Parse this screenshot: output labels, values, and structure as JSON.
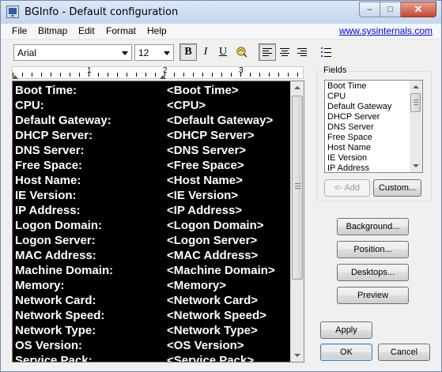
{
  "window": {
    "title": "BGInfo - Default configuration",
    "controls": {
      "minimize": "–",
      "maximize": "□",
      "close": "✕"
    }
  },
  "menu": {
    "items": [
      "File",
      "Bitmap",
      "Edit",
      "Format",
      "Help"
    ],
    "link": "www.sysinternals.com"
  },
  "toolbar": {
    "font": "Arial",
    "size": "12",
    "bold": "B",
    "italic": "I",
    "underline": "U",
    "icons": [
      "bold-icon",
      "italic-icon",
      "underline-icon",
      "insert-image-icon",
      "align-left-icon",
      "align-center-icon",
      "align-right-icon",
      "bullet-list-icon"
    ]
  },
  "ruler": {
    "marks": [
      "1",
      "2",
      "3"
    ]
  },
  "editor": {
    "lines": [
      {
        "label": "Boot Time:",
        "value": "<Boot Time>"
      },
      {
        "label": "CPU:",
        "value": "<CPU>"
      },
      {
        "label": "Default Gateway:",
        "value": "<Default Gateway>"
      },
      {
        "label": "DHCP Server:",
        "value": "<DHCP Server>"
      },
      {
        "label": "DNS Server:",
        "value": "<DNS Server>"
      },
      {
        "label": "Free Space:",
        "value": "<Free Space>"
      },
      {
        "label": "Host Name:",
        "value": "<Host Name>"
      },
      {
        "label": "IE Version:",
        "value": "<IE Version>"
      },
      {
        "label": "IP Address:",
        "value": "<IP Address>"
      },
      {
        "label": "Logon Domain:",
        "value": "<Logon Domain>"
      },
      {
        "label": "Logon Server:",
        "value": "<Logon Server>"
      },
      {
        "label": "MAC Address:",
        "value": "<MAC Address>"
      },
      {
        "label": "Machine Domain:",
        "value": "<Machine Domain>"
      },
      {
        "label": "Memory:",
        "value": "<Memory>"
      },
      {
        "label": "Network Card:",
        "value": "<Network Card>"
      },
      {
        "label": "Network Speed:",
        "value": "<Network Speed>"
      },
      {
        "label": "Network Type:",
        "value": "<Network Type>"
      },
      {
        "label": "OS Version:",
        "value": "<OS Version>"
      },
      {
        "label": "Service Pack:",
        "value": "<Service Pack>"
      }
    ],
    "background_color": "#000000",
    "text_color": "#ffffff"
  },
  "fields": {
    "legend": "Fields",
    "items": [
      "Boot Time",
      "CPU",
      "Default Gateway",
      "DHCP Server",
      "DNS Server",
      "Free Space",
      "Host Name",
      "IE Version",
      "IP Address"
    ],
    "add_label": "<- Add",
    "custom_label": "Custom..."
  },
  "buttons": {
    "background": "Background...",
    "position": "Position...",
    "desktops": "Desktops...",
    "preview": "Preview",
    "apply": "Apply",
    "ok": "OK",
    "cancel": "Cancel"
  }
}
